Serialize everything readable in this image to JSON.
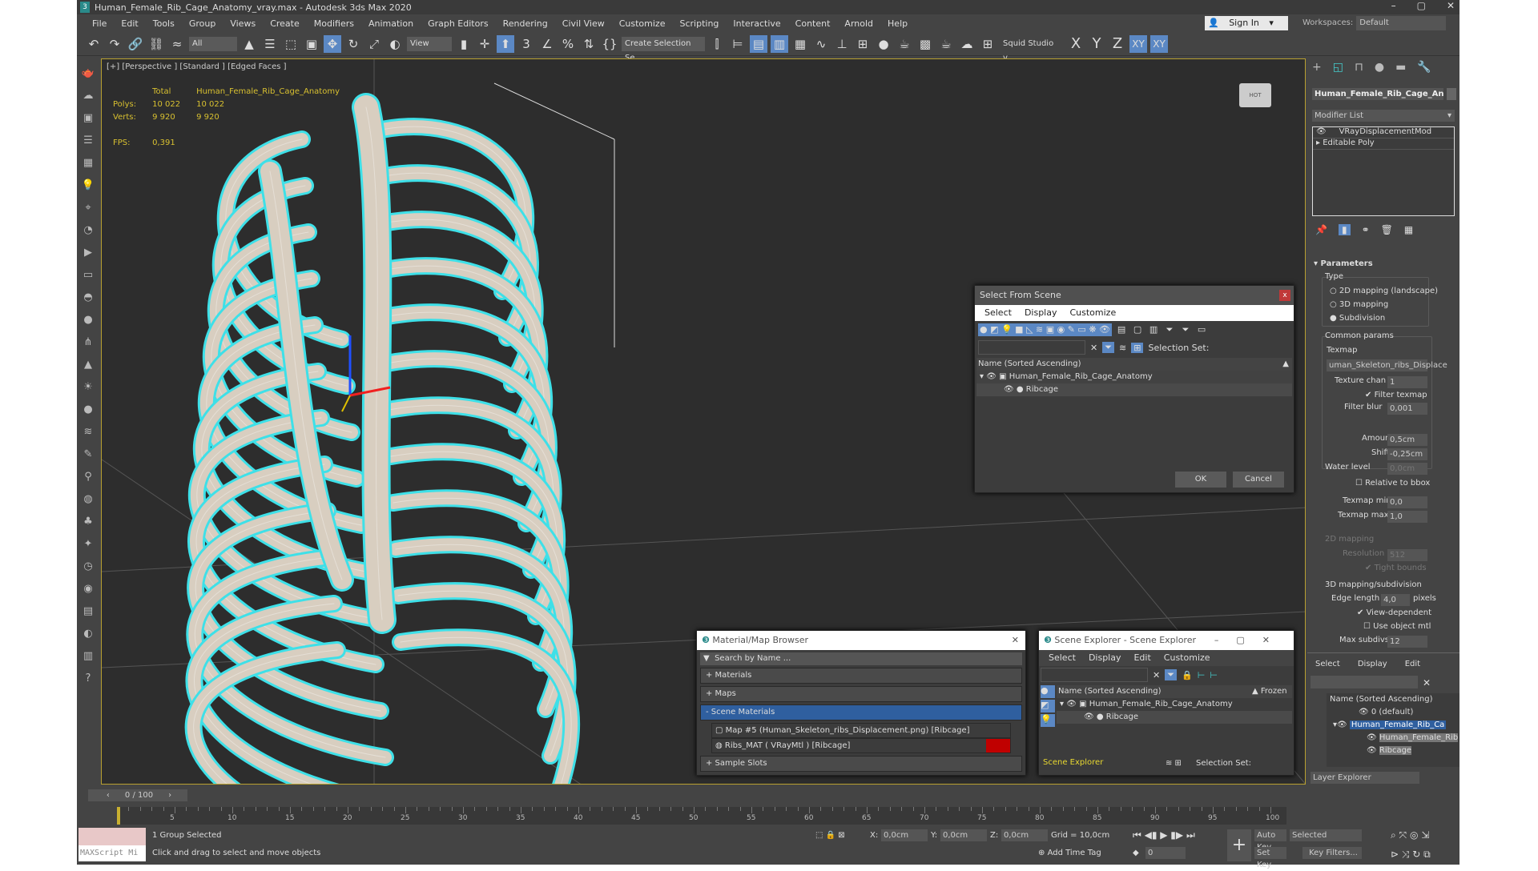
{
  "window": {
    "title": "Human_Female_Rib_Cage_Anatomy_vray.max - Autodesk 3ds Max 2020",
    "minimize": "–",
    "maximize": "▢",
    "close": "✕"
  },
  "menu": [
    "File",
    "Edit",
    "Tools",
    "Group",
    "Views",
    "Create",
    "Modifiers",
    "Animation",
    "Graph Editors",
    "Rendering",
    "Civil View",
    "Customize",
    "Scripting",
    "Interactive",
    "Content",
    "Arnold",
    "Help"
  ],
  "signin": "Sign In",
  "workspace_label": "Workspaces:",
  "workspace_value": "Default",
  "toolbar": {
    "filter": "All",
    "refcoord": "View",
    "selection_set": "Create Selection Se",
    "squid": "Squid Studio v",
    "axes": [
      "X",
      "Y",
      "Z",
      "XY",
      "XY"
    ]
  },
  "viewport": {
    "label": "[+] [Perspective ] [Standard ] [Edged Faces ]",
    "stats": {
      "col_total": "Total",
      "col_object": "Human_Female_Rib_Cage_Anatomy",
      "polys_label": "Polys:",
      "polys_total": "10 022",
      "polys_obj": "10 022",
      "verts_label": "Verts:",
      "verts_total": "9 920",
      "verts_obj": "9 920",
      "fps_label": "FPS:",
      "fps": "0,391"
    }
  },
  "command_panel": {
    "object_name": "Human_Female_Rib_Cage_An",
    "modifier_list": "Modifier List",
    "stack": [
      "VRayDisplacementMod",
      "Editable Poly"
    ],
    "parameters": {
      "title": "Parameters",
      "type_label": "Type",
      "types": [
        "2D mapping (landscape)",
        "3D mapping",
        "Subdivision"
      ],
      "selected_type": "Subdivision",
      "common": "Common params",
      "texmap_label": "Texmap",
      "texmap": "uman_Skeleton_ribs_Displace",
      "texture_chan_label": "Texture chan",
      "texture_chan": "1",
      "filter_texmap": "Filter texmap",
      "filter_blur_label": "Filter blur",
      "filter_blur": "0,001",
      "amount_label": "Amount",
      "amount": "0,5cm",
      "shift_label": "Shift",
      "shift": "-0,25cm",
      "water_label": "Water level",
      "water": "0,0cm",
      "relative": "Relative to bbox",
      "texmap_min_label": "Texmap min",
      "texmap_min": "0,0",
      "texmap_max_label": "Texmap max",
      "texmap_max": "1,0",
      "map2d": "2D mapping",
      "resolution_label": "Resolution",
      "resolution": "512",
      "tight": "Tight bounds",
      "map3d": "3D mapping/subdivision",
      "edge_label": "Edge length",
      "edge": "4,0",
      "pixels": "pixels",
      "view_dep": "View-dependent",
      "use_obj": "Use object mtl",
      "max_subdivs_label": "Max subdivs",
      "max_subdivs": "12"
    }
  },
  "layer_explorer": {
    "menu": [
      "Select",
      "Display",
      "Edit"
    ],
    "header": "Name (Sorted Ascending)",
    "items": [
      "0 (default)",
      "Human_Female_Rib_Ca",
      "Human_Female_Rib",
      "Ribcage"
    ],
    "footer": "Layer Explorer"
  },
  "select_dialog": {
    "title": "Select From Scene",
    "menu": [
      "Select",
      "Display",
      "Customize"
    ],
    "selection_set": "Selection Set:",
    "header": "Name (Sorted Ascending)",
    "items": [
      "Human_Female_Rib_Cage_Anatomy",
      "Ribcage"
    ],
    "ok": "OK",
    "cancel": "Cancel"
  },
  "material_browser": {
    "title": "Material/Map Browser",
    "search": "Search by Name ...",
    "sections": [
      "+ Materials",
      "+ Maps",
      "- Scene Materials",
      "+ Sample Slots"
    ],
    "items": [
      "Map #5 (Human_Skeleton_ribs_Displacement.png) [Ribcage]",
      "Ribs_MAT ( VRayMtl ) [Ribcage]"
    ]
  },
  "scene_explorer": {
    "title": "Scene Explorer - Scene Explorer",
    "menu": [
      "Select",
      "Display",
      "Edit",
      "Customize"
    ],
    "header": "Name (Sorted Ascending)",
    "frozen": "Frozen",
    "items": [
      "Human_Female_Rib_Cage_Anatomy",
      "Ribcage"
    ],
    "explorer": "Scene Explorer",
    "selection_set": "Selection Set:"
  },
  "timeline": {
    "frame": "0 / 100",
    "ticks": [
      "5",
      "10",
      "15",
      "20",
      "25",
      "30",
      "35",
      "40",
      "45",
      "50",
      "55",
      "60",
      "65",
      "70",
      "75",
      "80",
      "85",
      "90",
      "95",
      "100"
    ]
  },
  "status": {
    "maxscript": "MAXScript Mi",
    "selected": "1 Group Selected",
    "hint": "Click and drag to select and move objects",
    "x_label": "X:",
    "x": "0,0cm",
    "y_label": "Y:",
    "y": "0,0cm",
    "z_label": "Z:",
    "z": "0,0cm",
    "grid": "Grid = 10,0cm",
    "add_time_tag": "Add Time Tag",
    "frame": "0",
    "auto_key": "Auto Key",
    "set_key": "Set Key",
    "key_mode": "Selected",
    "key_filters": "Key Filters..."
  },
  "colors": {
    "accent": "#5b88c4",
    "viewport_border": "#b8a030",
    "stats": "#d8c030",
    "bone": "#d8cec0",
    "selection_outline": "#3ee0e8"
  }
}
